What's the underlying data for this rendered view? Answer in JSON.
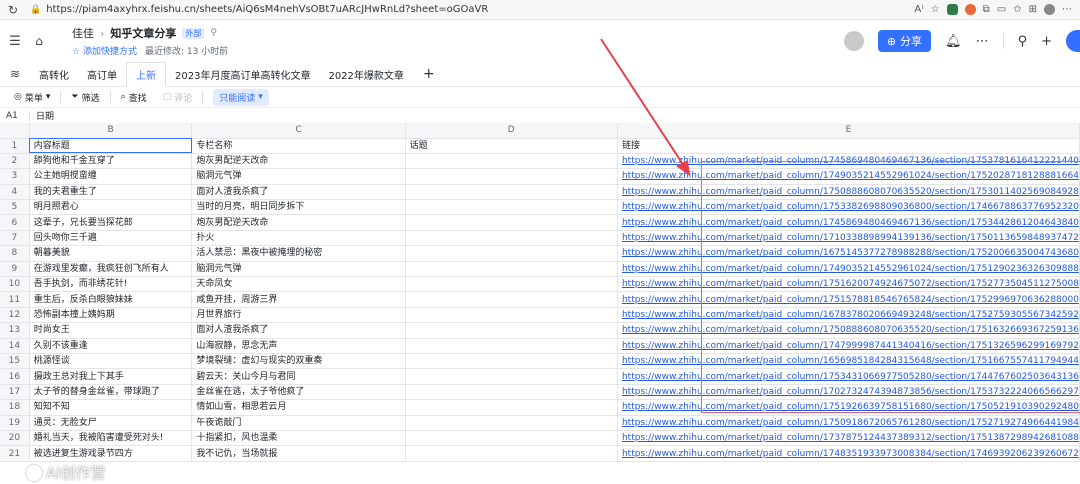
{
  "browser": {
    "url": "https://piam4axyhrx.feishu.cn/sheets/AiQ6sM4nehVsOBt7uARcJHwRnLd?sheet=oGOaVR"
  },
  "header": {
    "workspace": "佳佳",
    "doc_name": "知乎文章分享",
    "external_tag": "外部",
    "add_shortcut": "添加快捷方式",
    "last_modified": "最近修改: 13 小时前",
    "share_label": "分享"
  },
  "tabs": [
    {
      "label": "高转化"
    },
    {
      "label": "高订单"
    },
    {
      "label": "上新"
    },
    {
      "label": "2023年月度高订单高转化文章"
    },
    {
      "label": "2022年爆款文章"
    }
  ],
  "toolbar": {
    "menu": "菜单",
    "filter": "筛选",
    "find": "查找",
    "comment": "评论",
    "read_only": "只能阅读"
  },
  "formula": {
    "cell_ref": "A1",
    "value": "日期"
  },
  "columns": [
    "B",
    "C",
    "D",
    "E"
  ],
  "header_row": {
    "title": "内容标题",
    "column": "专栏名称",
    "topic": "话题",
    "link": "链接"
  },
  "rows": [
    {
      "n": "2",
      "title": "舔狗他和千金互穿了",
      "column": "炮灰男配逆天改命",
      "link": "https://www.zhihu.com/market/paid_column/1745869480469467136/section/1753781616412221440"
    },
    {
      "n": "3",
      "title": "公主她明搅蛮缠",
      "column": "脑洞元气弹",
      "link": "https://www.zhihu.com/market/paid_column/1749035214552961024/section/1752028718128881664"
    },
    {
      "n": "4",
      "title": "我的夫君重生了",
      "column": "面对人渣我杀疯了",
      "link": "https://www.zhihu.com/market/paid_column/1750888608070635520/section/1753011402569084928"
    },
    {
      "n": "5",
      "title": "明月照君心",
      "column": "当时的月亮，明日同步拆下",
      "link": "https://www.zhihu.com/market/paid_column/1753382698809036800/section/1746678863776952320"
    },
    {
      "n": "6",
      "title": "这辈子，兄长要当探花郎",
      "column": "炮灰男配逆天改命",
      "link": "https://www.zhihu.com/market/paid_column/1745869480469467136/section/1753442861204643840"
    },
    {
      "n": "7",
      "title": "回头吻你三千遍",
      "column": "扑火",
      "link": "https://www.zhihu.com/market/paid_column/1710338898994139136/section/1750113659848937472"
    },
    {
      "n": "8",
      "title": "朝暮美貌",
      "column": "活人禁忌：黑夜中被掩埋的秘密",
      "link": "https://www.zhihu.com/market/paid_column/1675145377278988288/section/1752006635004743680"
    },
    {
      "n": "9",
      "title": "在游戏里发癫，我疯狂创飞所有人",
      "column": "脑洞元气弹",
      "link": "https://www.zhihu.com/market/paid_column/1749035214552961024/section/1751290236326309888"
    },
    {
      "n": "10",
      "title": "吾手执剑，而非绣花针!",
      "column": "天命凤女",
      "link": "https://www.zhihu.com/market/paid_column/1751620074924675072/section/1752773504511275008"
    },
    {
      "n": "11",
      "title": "重生后，反杀白眼狼妹妹",
      "column": "咸鱼开挂，周游三界",
      "link": "https://www.zhihu.com/market/paid_column/1751578818546765824/section/1752996970636288000"
    },
    {
      "n": "12",
      "title": "恐怖副本撞上姨妈期",
      "column": "月世界旅行",
      "link": "https://www.zhihu.com/market/paid_column/1678378020669493248/section/1752759305567342592"
    },
    {
      "n": "13",
      "title": "时尚女王",
      "column": "面对人渣我杀疯了",
      "link": "https://www.zhihu.com/market/paid_column/1750888608070635520/section/1751632669367259136"
    },
    {
      "n": "14",
      "title": "久别不该重逢",
      "column": "山海寂静，思念无声",
      "link": "https://www.zhihu.com/market/paid_column/1747999987441340416/section/1751326596299169792"
    },
    {
      "n": "15",
      "title": "桃源怪谈",
      "column": "梦境裂缝：虚幻与现实的双重奏",
      "link": "https://www.zhihu.com/market/paid_column/1656985184284315648/section/1751667557411794944"
    },
    {
      "n": "16",
      "title": "摄政王总对我上下其手",
      "column": "碧云天：关山今月与君同",
      "link": "https://www.zhihu.com/market/paid_column/1753431066977505280/section/1744767602503643136"
    },
    {
      "n": "17",
      "title": "太子爷的替身金丝雀，带球跑了",
      "column": "金丝雀在逃，太子爷他疯了",
      "link": "https://www.zhihu.com/market/paid_column/1702732474394873856/section/1753732224066566297"
    },
    {
      "n": "18",
      "title": "知知不知",
      "column": "情如山雪，相思若云月",
      "link": "https://www.zhihu.com/market/paid_column/1751926639758151680/section/1750521910390292480"
    },
    {
      "n": "19",
      "title": "通灵：无脸女尸",
      "column": "午夜诡敲门",
      "link": "https://www.zhihu.com/market/paid_column/1750918672065761280/section/1752719274966441984"
    },
    {
      "n": "20",
      "title": "婚礼当天，我被陷害遭受死对头!",
      "column": "十指紧扣，风也温柔",
      "link": "https://www.zhihu.com/market/paid_column/1737875124437389312/section/1751387298942681088"
    },
    {
      "n": "21",
      "title": "被选进复生游戏录节四方",
      "column": "我不记仇，当场就报",
      "link": "https://www.zhihu.com/market/paid_column/1748351933973008384/section/1746939206239260672"
    }
  ],
  "watermark": "AI创作营",
  "colors": {
    "accent": "#3370ff",
    "link": "#245bdb",
    "annotation": "#e5626e"
  }
}
